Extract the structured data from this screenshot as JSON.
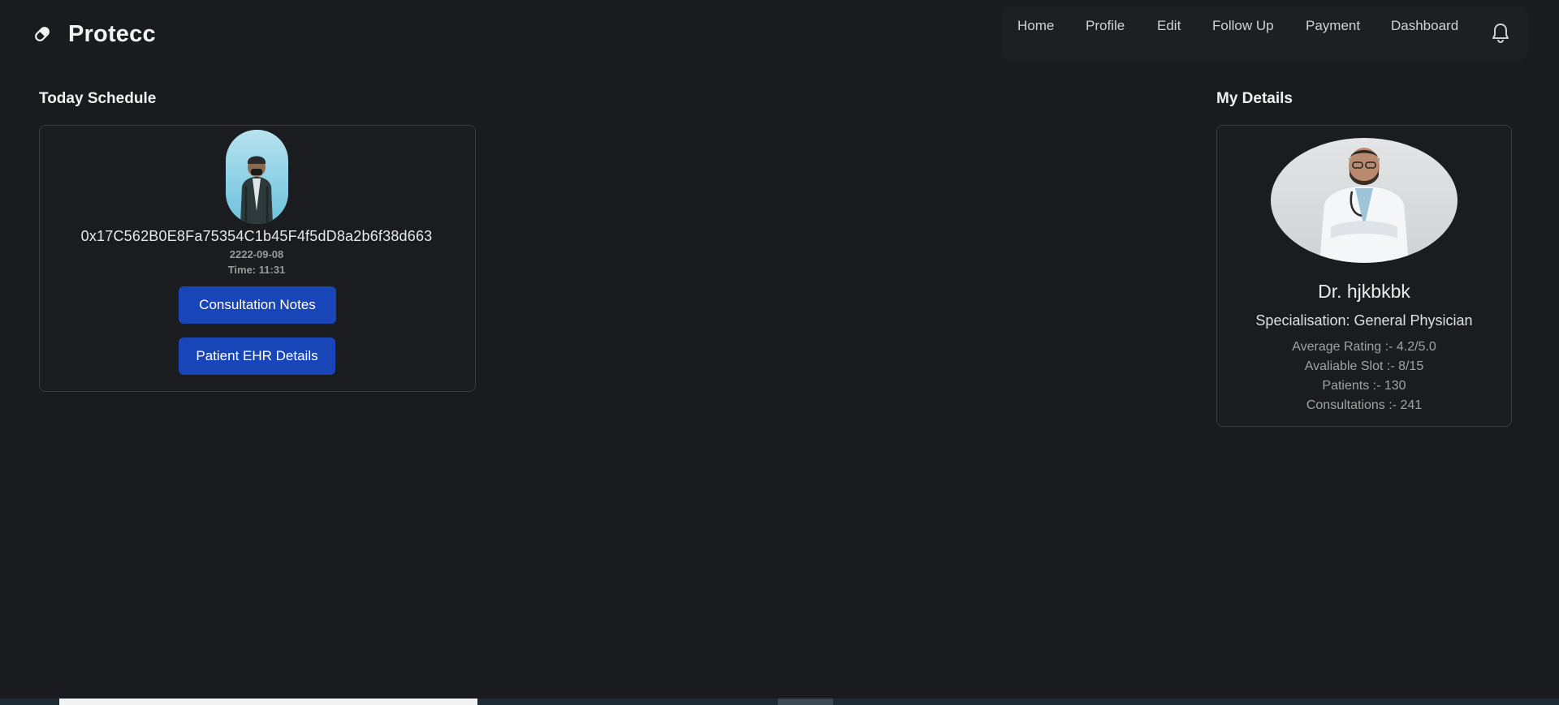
{
  "brand": {
    "name": "Protecc",
    "icon": "pill-icon"
  },
  "nav": {
    "items": [
      "Home",
      "Profile",
      "Edit",
      "Follow Up",
      "Payment",
      "Dashboard"
    ],
    "bell_icon": "bell-icon"
  },
  "schedule": {
    "title": "Today Schedule",
    "appointment": {
      "patient_id": "0x17C562B0E8Fa75354C1b45F4f5dD8a2b6f38d663",
      "date": "2222-09-08",
      "time": "Time: 11:31"
    },
    "buttons": {
      "notes": "Consultation Notes",
      "ehr": "Patient EHR Details"
    }
  },
  "details": {
    "title": "My Details",
    "name": "Dr. hjkbkbk",
    "specialisation": "Specialisation: General Physician",
    "stats": [
      "Average Rating :- 4.2/5.0",
      "Avaliable Slot :- 8/15",
      "Patients :- 130",
      "Consultations :- 241"
    ]
  },
  "colors": {
    "background": "#1a1b1e",
    "button": "#1845b8",
    "card_border": "#3a3b3f"
  }
}
